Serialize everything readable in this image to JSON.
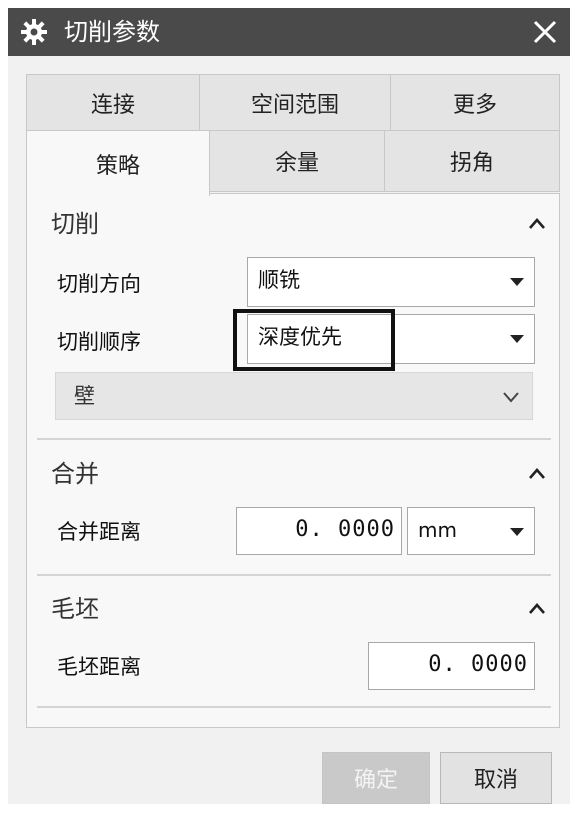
{
  "window": {
    "title": "切削参数",
    "icon": "gear-icon",
    "close_icon": "close-icon"
  },
  "tabs": {
    "row1": [
      {
        "label": "连接"
      },
      {
        "label": "空间范围"
      },
      {
        "label": "更多"
      }
    ],
    "row2": [
      {
        "label": "策略",
        "active": true
      },
      {
        "label": "余量"
      },
      {
        "label": "拐角"
      }
    ]
  },
  "sections": {
    "cut": {
      "title": "切削",
      "cut_direction": {
        "label": "切削方向",
        "value": "顺铣"
      },
      "cut_order": {
        "label": "切削顺序",
        "value": "深度优先"
      },
      "wall": {
        "label": "壁"
      }
    },
    "merge": {
      "title": "合并",
      "merge_distance": {
        "label": "合并距离",
        "value": "0. 0000",
        "unit": "mm"
      }
    },
    "blank": {
      "title": "毛坯",
      "blank_distance": {
        "label": "毛坯距离",
        "value": "0. 0000"
      }
    }
  },
  "buttons": {
    "ok": "确定",
    "cancel": "取消"
  },
  "colors": {
    "titlebar": "#4a4a4a",
    "panel": "#f8f8f8",
    "dialog": "#f1f1f1"
  }
}
